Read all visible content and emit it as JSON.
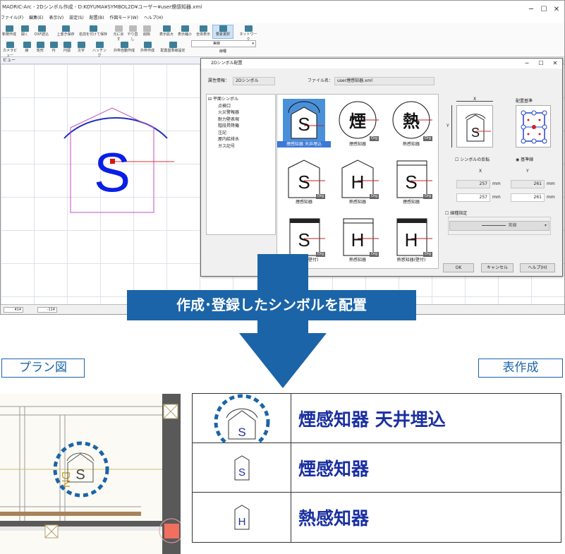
{
  "app": {
    "title": "MADRIC-Arc - 2Dシンボル作成 - D:KOYUMA¥SYMBOL2D¥ユーザー¥user煙感知器.xml",
    "controls": {
      "minimize": "─",
      "maximize": "☐",
      "close": "✕"
    }
  },
  "menu": [
    "ファイル(F)",
    "編集(E)",
    "表示(V)",
    "設定(S)",
    "配置(B)",
    "作図モード(W)",
    "ヘルプ(H)"
  ],
  "toolbar": {
    "row1": [
      "新規作成",
      "開く",
      "DXF読込",
      "上書き保存",
      "名前を付けて保存",
      "元に戻す",
      "やり直し",
      "削除",
      "表示拡大",
      "表示縮小",
      "全体表示",
      "要素選択",
      "ネットワーク"
    ],
    "row2": [
      "カメラビュー",
      "線",
      "矩形",
      "円",
      "円弧",
      "文字",
      "ハッチング",
      "外枠自動作成",
      "外枠作成",
      "配置基準線設定"
    ],
    "line_type": "実線",
    "line_label": "線種"
  },
  "view_title": "ビュー",
  "status": {
    "x": "414",
    "y": "-114"
  },
  "dialog": {
    "title": "2Dシンボル配置",
    "attr_label": "属性情報：",
    "attr_value": "2Dシンボル",
    "file_label": "ファイル名：",
    "file_value": "user煙感知器.xml",
    "tree": {
      "root": "平面シンボル",
      "items": [
        "点検口",
        "火災警報器",
        "耐力壁表現",
        "階段昇降機",
        "注記",
        "屋内給排水",
        "ガス記号"
      ]
    },
    "symbols": [
      {
        "glyph": "S",
        "label": "煙感知器 天井埋込",
        "kind": "dome",
        "selected": true
      },
      {
        "glyph": "煙",
        "label": "煙感知器",
        "kind": "circle",
        "org": "Org"
      },
      {
        "glyph": "熱",
        "label": "熱感知器",
        "kind": "circle",
        "org": "Org"
      },
      {
        "glyph": "S",
        "label": "煙感知器",
        "kind": "house",
        "org": "Org"
      },
      {
        "glyph": "H",
        "label": "熱感知器",
        "kind": "house",
        "org": "Org"
      },
      {
        "glyph": "S",
        "label": "煙感知器",
        "kind": "box",
        "org": "Org"
      },
      {
        "glyph": "S",
        "label": "煙感知器(壁付)",
        "kind": "wall",
        "org": "Org"
      },
      {
        "glyph": "H",
        "label": "熱感知器",
        "kind": "box",
        "org": "Org"
      },
      {
        "glyph": "H",
        "label": "熱感知器(壁付)",
        "kind": "wall",
        "org": "Org"
      }
    ],
    "x_label": "X",
    "y_label": "Y",
    "preview_glyph": "S",
    "kijun_label": "配置基準",
    "mirror_label": "シンボルの反転",
    "baseline_label": "基準線",
    "size_x_label": "X",
    "size_y_label": "Y",
    "size_values": {
      "x1": "257",
      "y1": "261",
      "x2": "257",
      "y2": "261"
    },
    "unit": "mm",
    "linetype_check": "線種指定",
    "linetype_value": "実線",
    "buttons": {
      "ok": "OK",
      "cancel": "キャンセル",
      "help": "ヘルプ(H)"
    }
  },
  "banner": "作成･登録したシンボルを配置",
  "plan_tag": "プラン図",
  "table_tag": "表作成",
  "plan": {
    "glyph": "S",
    "label": "DN"
  },
  "table": [
    {
      "glyph": "S",
      "label": "煙感知器 天井埋込",
      "kind": "dome"
    },
    {
      "glyph": "S",
      "label": "煙感知器",
      "kind": "house"
    },
    {
      "glyph": "H",
      "label": "熱感知器",
      "kind": "house"
    }
  ],
  "colors": {
    "accent": "#1b64a8",
    "symbol_blue": "#0a1ee8",
    "text_blue": "#1a2fa0"
  }
}
